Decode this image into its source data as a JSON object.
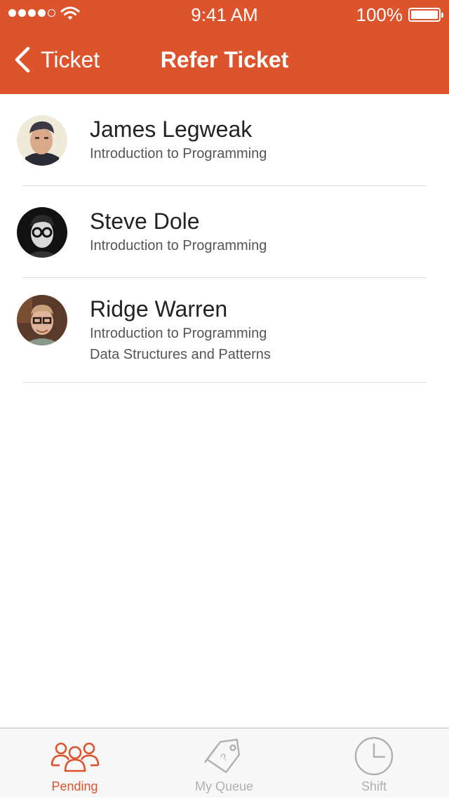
{
  "colors": {
    "accent": "#dd532c",
    "inactive_tab": "#b0b0b0",
    "divider": "#dddddd"
  },
  "status_bar": {
    "time": "9:41 AM",
    "battery": "100%"
  },
  "nav": {
    "back_label": "Ticket",
    "title": "Refer Ticket"
  },
  "people": [
    {
      "name": "James Legweak",
      "courses": [
        "Introduction to Programming"
      ]
    },
    {
      "name": "Steve Dole",
      "courses": [
        "Introduction to Programming"
      ]
    },
    {
      "name": "Ridge Warren",
      "courses": [
        "Introduction to Programming",
        "Data Structures and Patterns"
      ]
    }
  ],
  "tabs": [
    {
      "label": "Pending",
      "icon": "people-icon",
      "active": true
    },
    {
      "label": "My Queue",
      "icon": "tag-icon",
      "active": false
    },
    {
      "label": "Shift",
      "icon": "clock-icon",
      "active": false
    }
  ]
}
